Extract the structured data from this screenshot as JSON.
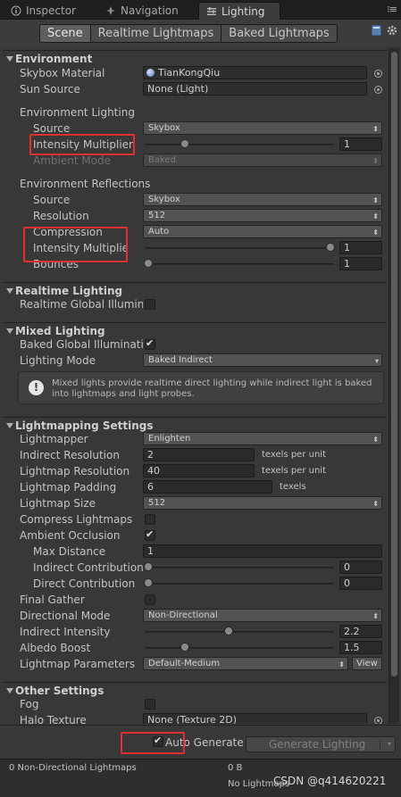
{
  "tabs": [
    {
      "label": "Inspector"
    },
    {
      "label": "Navigation"
    },
    {
      "label": "Lighting"
    }
  ],
  "segments": [
    {
      "label": "Scene"
    },
    {
      "label": "Realtime Lightmaps"
    },
    {
      "label": "Baked Lightmaps"
    }
  ],
  "environment": {
    "title": "Environment",
    "skybox_label": "Skybox Material",
    "skybox_value": "TianKongQiu",
    "sun_label": "Sun Source",
    "sun_value": "None (Light)",
    "lighting_title": "Environment Lighting",
    "source_label": "Source",
    "source_value": "Skybox",
    "intensity_label": "Intensity Multiplier",
    "intensity_value": "1",
    "intensity_slider": 0.2,
    "ambient_label": "Ambient Mode",
    "ambient_value": "Baked",
    "reflections_title": "Environment Reflections",
    "r_source_label": "Source",
    "r_source_value": "Skybox",
    "resolution_label": "Resolution",
    "resolution_value": "512",
    "compression_label": "Compression",
    "compression_value": "Auto",
    "r_intensity_label": "Intensity Multiplier",
    "r_intensity_value": "1",
    "r_intensity_slider": 1.0,
    "bounces_label": "Bounces",
    "bounces_value": "1",
    "bounces_slider": 0.0
  },
  "realtime": {
    "title": "Realtime Lighting",
    "gi_label": "Realtime Global Illumina",
    "gi_checked": false
  },
  "mixed": {
    "title": "Mixed Lighting",
    "baked_gi_label": "Baked Global Illuminatio",
    "baked_gi_checked": true,
    "mode_label": "Lighting Mode",
    "mode_value": "Baked Indirect",
    "help_text": "Mixed lights provide realtime direct lighting while indirect light is baked into lightmaps and light probes."
  },
  "lightmapping": {
    "title": "Lightmapping Settings",
    "lightmapper_label": "Lightmapper",
    "lightmapper_value": "Enlighten",
    "indirect_res_label": "Indirect Resolution",
    "indirect_res_value": "2",
    "indirect_res_units": "texels per unit",
    "lightmap_res_label": "Lightmap Resolution",
    "lightmap_res_value": "40",
    "lightmap_res_units": "texels per unit",
    "padding_label": "Lightmap Padding",
    "padding_value": "6",
    "padding_units": "texels",
    "size_label": "Lightmap Size",
    "size_value": "512",
    "compress_label": "Compress Lightmaps",
    "compress_checked": false,
    "ao_label": "Ambient Occlusion",
    "ao_checked": true,
    "max_dist_label": "Max Distance",
    "max_dist_value": "1",
    "indirect_contrib_label": "Indirect Contribution",
    "indirect_contrib_value": "0",
    "indirect_contrib_slider": 0.0,
    "direct_contrib_label": "Direct Contribution",
    "direct_contrib_value": "0",
    "direct_contrib_slider": 0.0,
    "final_gather_label": "Final Gather",
    "final_gather_checked": false,
    "dir_mode_label": "Directional Mode",
    "dir_mode_value": "Non-Directional",
    "indirect_int_label": "Indirect Intensity",
    "indirect_int_value": "2.2",
    "indirect_int_slider": 0.44,
    "albedo_label": "Albedo Boost",
    "albedo_value": "1.5",
    "albedo_slider": 0.2,
    "params_label": "Lightmap Parameters",
    "params_value": "Default-Medium",
    "view_label": "View"
  },
  "other": {
    "title": "Other Settings",
    "fog_label": "Fog",
    "fog_checked": false,
    "halo_label": "Halo Texture",
    "halo_value": "None (Texture 2D)"
  },
  "bottom": {
    "auto_generate_label": "Auto Generate",
    "auto_generate_checked": true,
    "generate_label": "Generate Lighting"
  },
  "stats": {
    "lightmaps_label": "0 Non-Directional Lightmaps",
    "size": "0 B",
    "no_lightmaps": "No Lightmaps",
    "watermark": "CSDN @q414620221"
  },
  "colors": {
    "highlight": "#e03030",
    "background": "#383838"
  }
}
